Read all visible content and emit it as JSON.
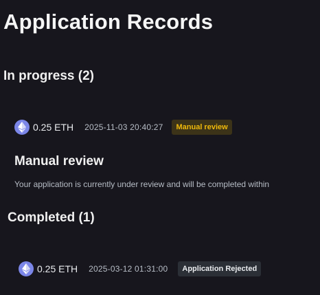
{
  "page": {
    "title": "Application Records"
  },
  "in_progress": {
    "heading": "In progress (2)",
    "records": [
      {
        "icon": "ethereum-icon",
        "amount": "0.25 ETH",
        "timestamp": "2025-11-03 20:40:27",
        "status": "Manual review",
        "status_color": "#f0b90b"
      }
    ],
    "detail": {
      "title": "Manual review",
      "description": "Your application is currently under review and will be completed within"
    }
  },
  "completed": {
    "heading": "Completed (1)",
    "records": [
      {
        "icon": "ethereum-icon",
        "amount": "0.25 ETH",
        "timestamp": "2025-03-12 01:31:00",
        "status": "Application Rejected",
        "status_color": "#eaecef"
      }
    ]
  },
  "colors": {
    "background": "#17161d",
    "eth_icon": "#7b86e8",
    "review_badge_bg": "#3c3318",
    "rejected_badge_bg": "#2b2f36"
  }
}
